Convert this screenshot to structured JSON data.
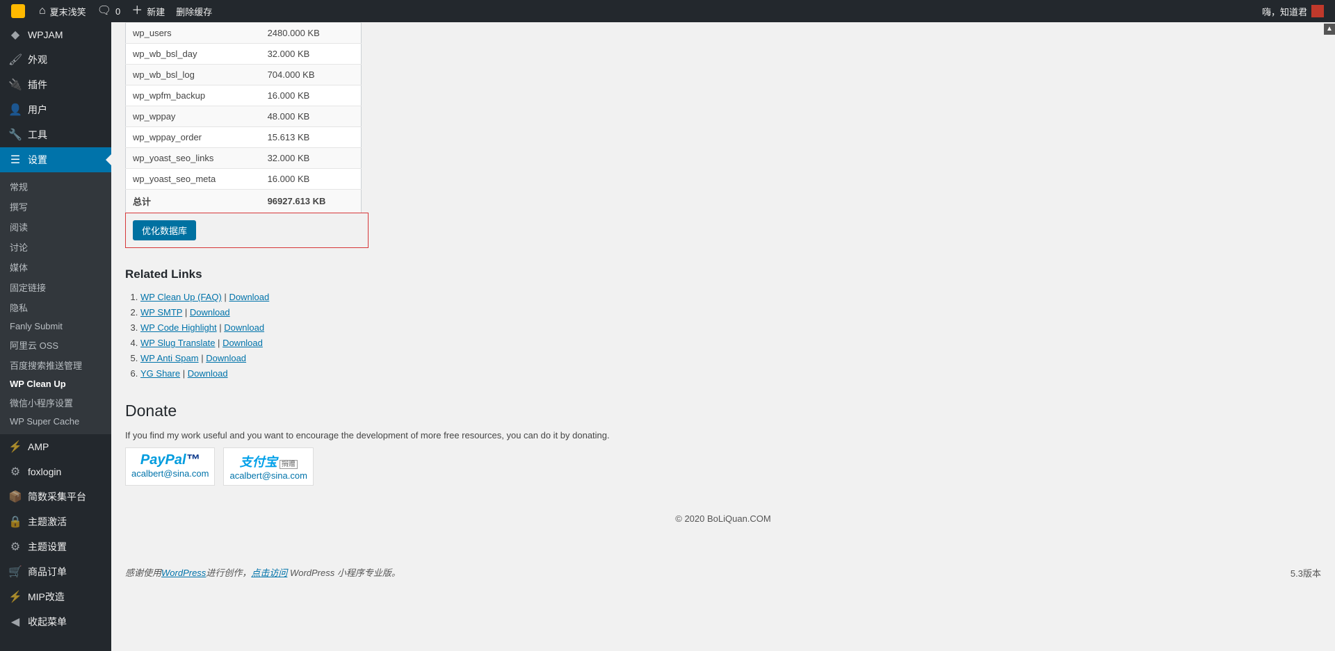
{
  "adminbar": {
    "site_title": "夏末浅笑",
    "comments": "0",
    "new": "新建",
    "clear_cache": "删除缓存",
    "greeting": "嗨，知道君"
  },
  "sidebar": {
    "main": [
      {
        "icon": "wpjam",
        "label": "WPJAM"
      },
      {
        "icon": "brush",
        "label": "外观"
      },
      {
        "icon": "plug",
        "label": "插件"
      },
      {
        "icon": "user",
        "label": "用户"
      },
      {
        "icon": "wrench",
        "label": "工具"
      },
      {
        "icon": "sliders",
        "label": "设置",
        "current": true
      }
    ],
    "settings_submenu": [
      "常规",
      "撰写",
      "阅读",
      "讨论",
      "媒体",
      "固定链接",
      "隐私",
      "Fanly Submit",
      "阿里云 OSS",
      "百度搜索推送管理",
      "WP Clean Up",
      "微信小程序设置",
      "WP Super Cache"
    ],
    "settings_current": "WP Clean Up",
    "after": [
      {
        "icon": "bolt",
        "label": "AMP"
      },
      {
        "icon": "gear",
        "label": "foxlogin"
      },
      {
        "icon": "box",
        "label": "简数采集平台"
      },
      {
        "icon": "lock",
        "label": "主题激活"
      },
      {
        "icon": "gear",
        "label": "主题设置"
      },
      {
        "icon": "cart",
        "label": "商品订单"
      },
      {
        "icon": "bolt",
        "label": "MIP改造"
      },
      {
        "icon": "collapse",
        "label": "收起菜单"
      }
    ]
  },
  "table_rows": [
    {
      "name": "wp_users",
      "size": "2480.000 KB"
    },
    {
      "name": "wp_wb_bsl_day",
      "size": "32.000 KB"
    },
    {
      "name": "wp_wb_bsl_log",
      "size": "704.000 KB"
    },
    {
      "name": "wp_wpfm_backup",
      "size": "16.000 KB"
    },
    {
      "name": "wp_wppay",
      "size": "48.000 KB"
    },
    {
      "name": "wp_wppay_order",
      "size": "15.613 KB"
    },
    {
      "name": "wp_yoast_seo_links",
      "size": "32.000 KB"
    },
    {
      "name": "wp_yoast_seo_meta",
      "size": "16.000 KB"
    }
  ],
  "total": {
    "label": "总计",
    "size": "96927.613 KB"
  },
  "optimize_button": "优化数据库",
  "related": {
    "heading": "Related Links",
    "items": [
      {
        "name": "WP Clean Up (FAQ)",
        "dl": "Download"
      },
      {
        "name": "WP SMTP",
        "dl": "Download"
      },
      {
        "name": "WP Code Highlight",
        "dl": "Download"
      },
      {
        "name": "WP Slug Translate",
        "dl": "Download"
      },
      {
        "name": "WP Anti Spam",
        "dl": "Download"
      },
      {
        "name": "YG Share",
        "dl": "Download"
      }
    ]
  },
  "donate": {
    "heading": "Donate",
    "text": "If you find my work useful and you want to encourage the development of more free resources, you can do it by donating.",
    "paypal_brand_a": "Pay",
    "paypal_brand_b": "Pal",
    "alipay_brand": "支付宝",
    "alipay_tag": "捐赠",
    "email": "acalbert@sina.com"
  },
  "copyright": "© 2020 BoLiQuan.COM",
  "footer": {
    "thanks_a": "感谢使用",
    "wp": "WordPress",
    "thanks_b": "进行创作，",
    "visit": "点击访问",
    "tail": " WordPress 小程序专业版。",
    "version": "5.3版本"
  }
}
